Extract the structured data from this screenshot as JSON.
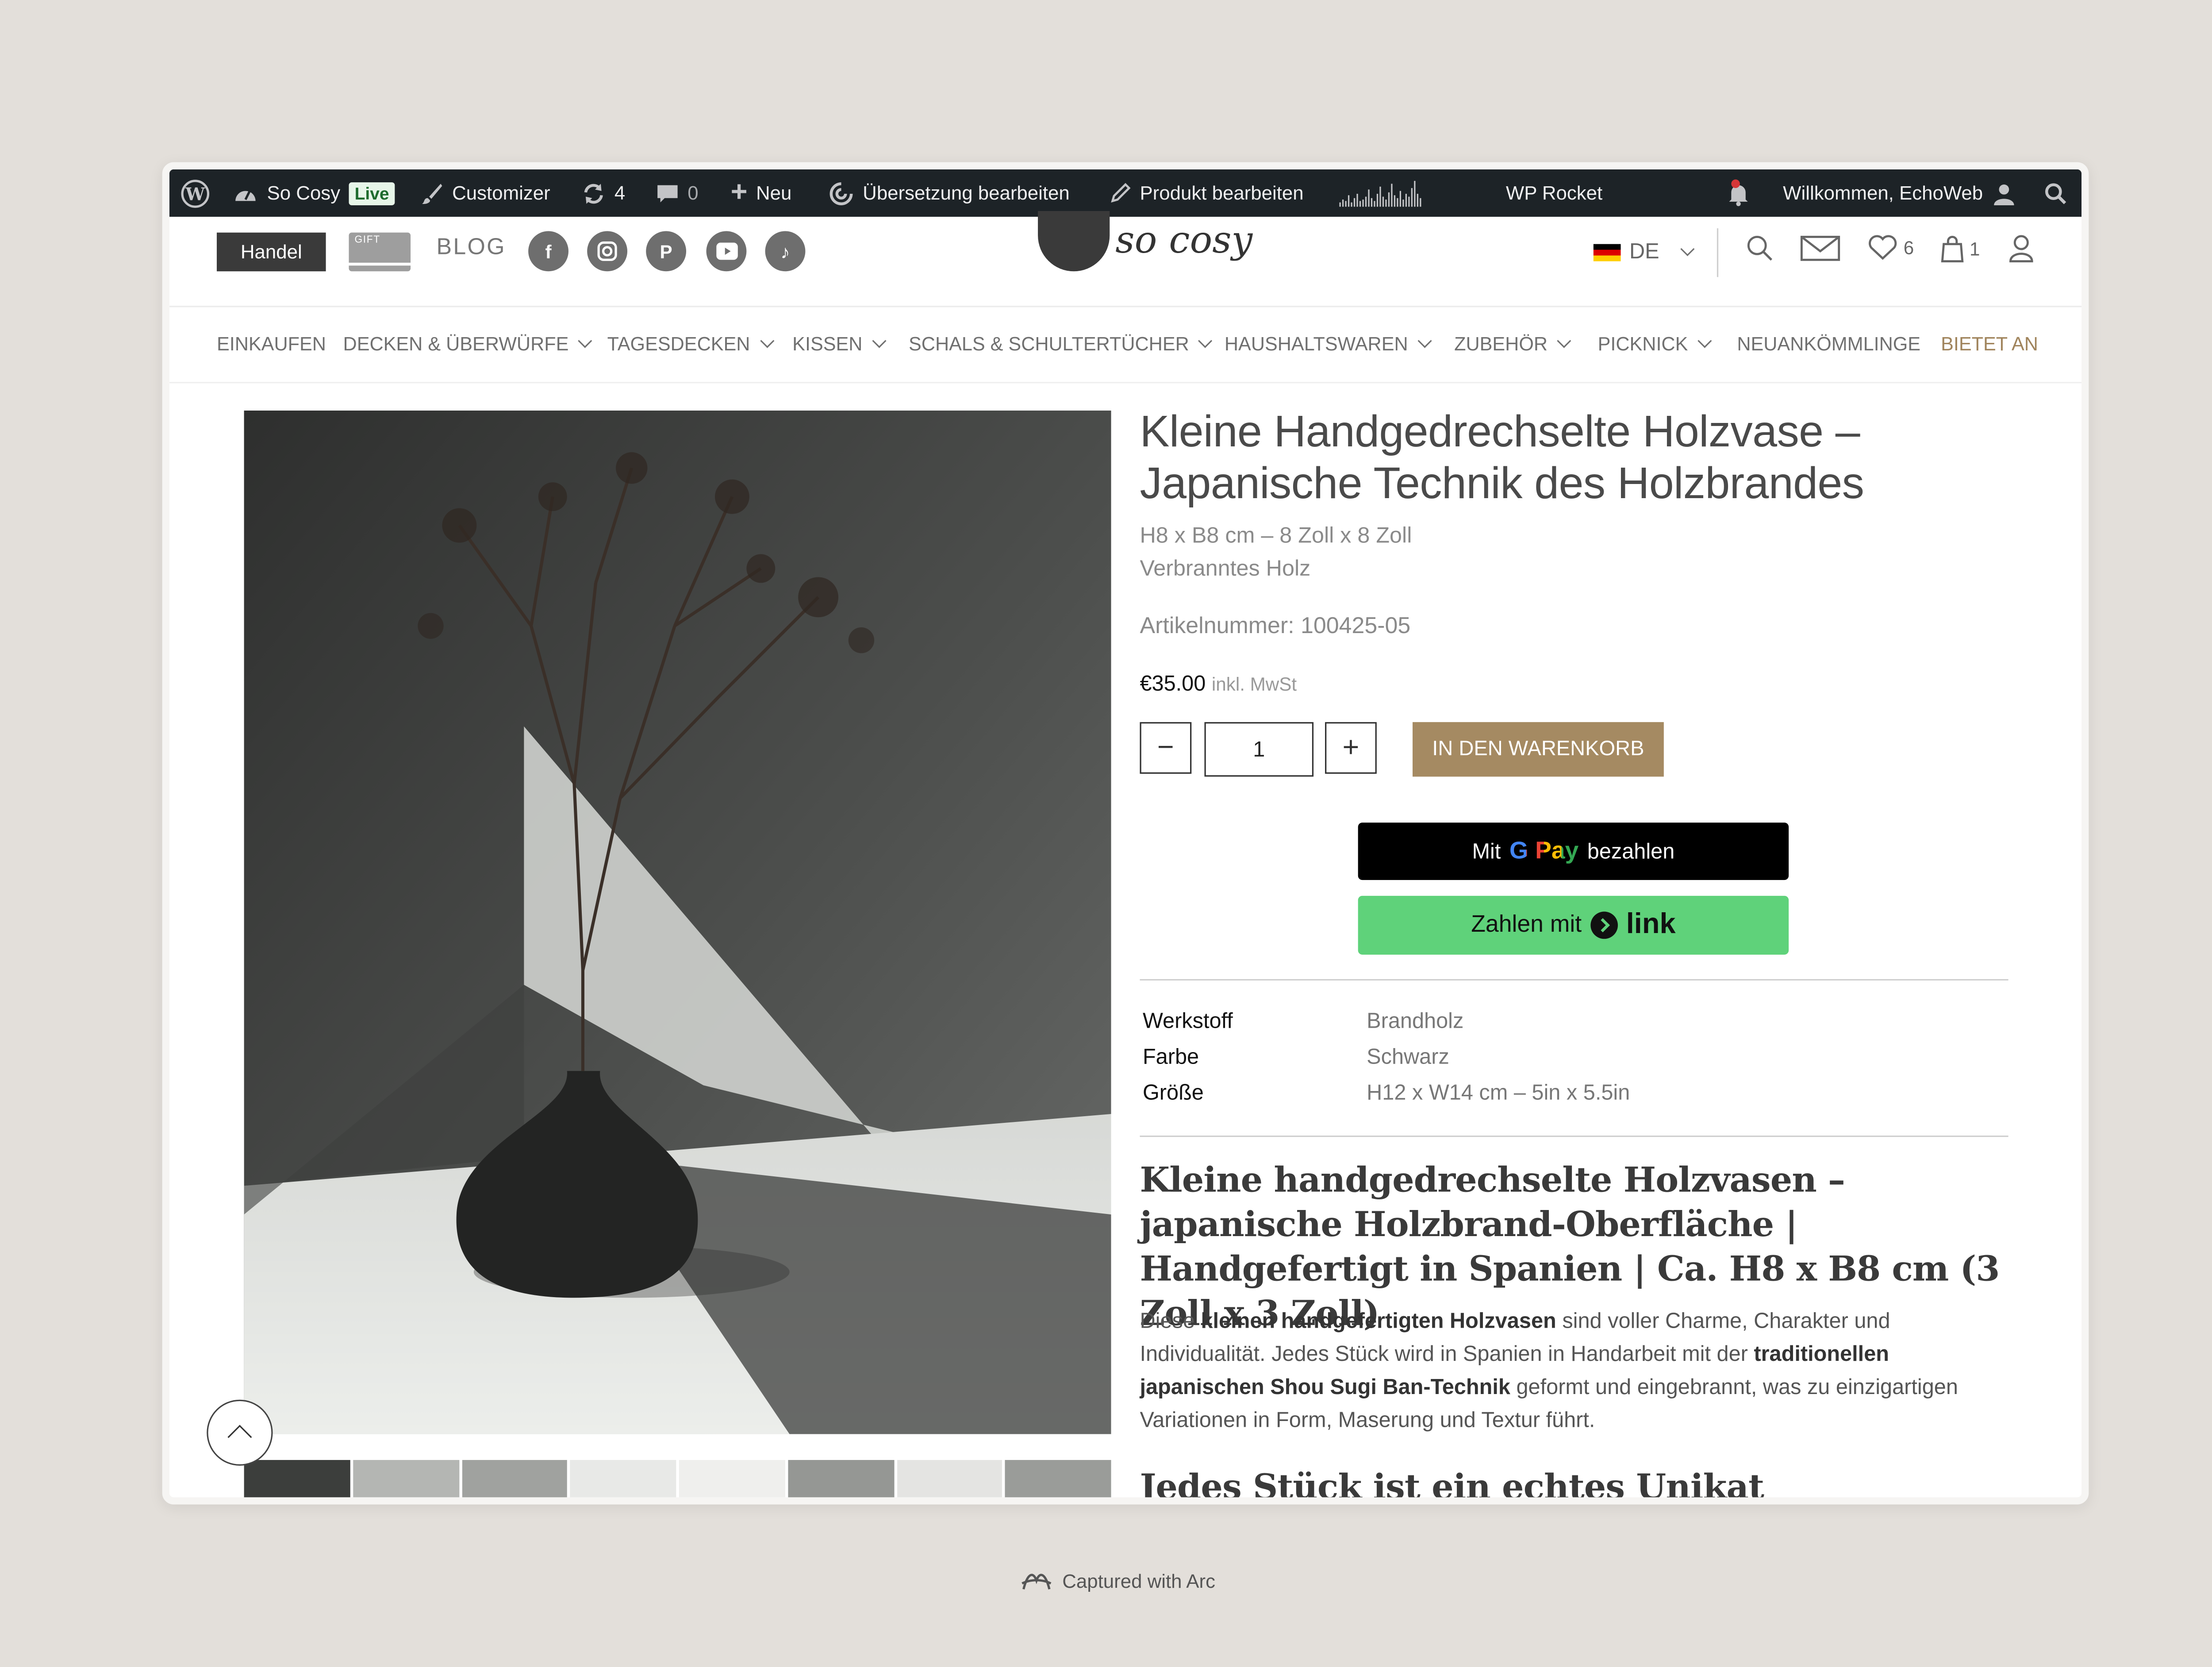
{
  "adminbar": {
    "site_name": "So Cosy",
    "live_badge": "Live",
    "customizer": "Customizer",
    "updates_count": "4",
    "comments_count": "0",
    "new_label": "Neu",
    "translate_label": "Übersetzung bearbeiten",
    "edit_product_label": "Produkt bearbeiten",
    "wp_rocket_label": "WP Rocket",
    "welcome": "Willkommen, EchoWeb"
  },
  "header": {
    "handel_label": "Handel",
    "gift_label": "GIFT",
    "blog_label": "BLOG",
    "social_icons": [
      "facebook-icon",
      "instagram-icon",
      "pinterest-icon",
      "youtube-icon",
      "tiktok-icon"
    ],
    "logo_text": "so cosy",
    "language": "DE",
    "wishlist_count": "6",
    "cart_count": "1"
  },
  "menu": {
    "items": [
      {
        "label": "EINKAUFEN"
      },
      {
        "label": "DECKEN & ÜBERWÜRFE"
      },
      {
        "label": "TAGESDECKEN"
      },
      {
        "label": "KISSEN"
      },
      {
        "label": "SCHALS & SCHULTERTÜCHER"
      },
      {
        "label": "HAUSHALTSWAREN"
      },
      {
        "label": "ZUBEHÖR"
      },
      {
        "label": "PICKNICK"
      },
      {
        "label": "NEUANKÖMMLINGE"
      },
      {
        "label": "BIETET AN"
      }
    ],
    "accent_color": "#a0845c"
  },
  "product": {
    "title": "Kleine Handgedrechselte Holzvase – Japanische Technik des Holzbrandes",
    "size_line": "H8 x B8 cm – 8 Zoll x 8 Zoll",
    "material_line": "Verbranntes Holz",
    "sku_line": "Artikelnummer: 100425-05",
    "price": "€35.00",
    "price_note": "inkl. MwSt",
    "quantity": "1",
    "add_to_cart": "IN DEN WARENKORB",
    "add_to_cart_color": "#a58a62",
    "gpay_prefix": "Mit",
    "gpay_brand": "G Pay",
    "gpay_suffix": "bezahlen",
    "link_prefix": "Zahlen mit",
    "link_brand": "link",
    "link_color": "#5fd27a",
    "attributes": [
      {
        "label": "Werkstoff",
        "value": "Brandholz"
      },
      {
        "label": "Farbe",
        "value": "Schwarz"
      },
      {
        "label": "Größe",
        "value": "H12 x W14 cm – 5in x 5.5in"
      }
    ],
    "desc_heading": "Kleine handgedrechselte Holzvasen – japanische Holzbrand-Oberfläche | Handgefertigt in Spanien | Ca. H8 x B8 cm (3 Zoll x 3 Zoll)",
    "desc_p1": "Diese",
    "desc_b1": "kleinen handgefertigten Holzvasen",
    "desc_p2": "sind voller Charme, Charakter und Individualität. Jedes Stück wird in Spanien in Handarbeit mit der",
    "desc_b2": "traditionellen japanischen Shou Sugi Ban-Technik",
    "desc_p3": "geformt und eingebrannt, was zu einzigartigen Variationen in Form, Maserung und Textur führt.",
    "desc_heading2": "Jedes Stück ist ein echtes Unikat"
  },
  "footer": {
    "capture_label": "Captured with Arc"
  }
}
